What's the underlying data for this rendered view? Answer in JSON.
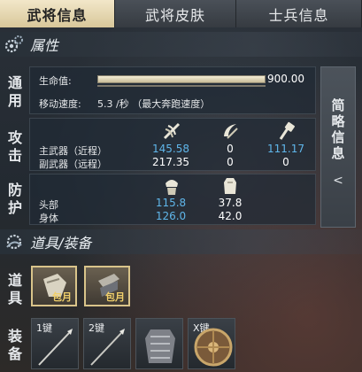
{
  "tabs": [
    {
      "label": "武将信息",
      "active": true
    },
    {
      "label": "武将皮肤",
      "active": false
    },
    {
      "label": "士兵信息",
      "active": false
    }
  ],
  "attributes": {
    "title": "属性",
    "general": {
      "side_label": "通用",
      "hp_label": "生命值:",
      "hp_value": "900.00",
      "hp_fill": 1.0,
      "speed_label": "移动速度:",
      "speed_value": "5.3 /秒 （最大奔跑速度）"
    },
    "attack": {
      "side_label": "攻击",
      "main_label": "主武器（近程）",
      "sub_label": "副武器（远程）",
      "columns": [
        {
          "icon": "slash-attack-icon",
          "main": "145.58",
          "sub": "217.35"
        },
        {
          "icon": "crescent-blade-icon",
          "main": "0",
          "sub": "0"
        },
        {
          "icon": "blunt-hammer-icon",
          "main": "111.17",
          "sub": "0"
        }
      ]
    },
    "defense": {
      "side_label": "防护",
      "head_label": "头部",
      "body_label": "身体",
      "columns": [
        {
          "icon": "helmet-armor-icon",
          "head": "115.8",
          "body": "126.0"
        },
        {
          "icon": "body-armor-icon",
          "head": "37.8",
          "body": "42.0"
        }
      ]
    }
  },
  "side_tab": {
    "label": "简略信息",
    "arrow": "<"
  },
  "equipment": {
    "title": "道具/装备",
    "items_side_label": "道具",
    "gear_side_label": "装备",
    "items": [
      {
        "tag": "包月",
        "icon": "gauntlet-item-icon"
      },
      {
        "tag": "包月",
        "icon": "armguard-item-icon"
      }
    ],
    "gear": [
      {
        "key": "1键",
        "icon": "spear-icon"
      },
      {
        "key": "2键",
        "icon": "javelin-icon"
      },
      {
        "key": "",
        "icon": "chest-armor-icon"
      },
      {
        "key": "X键",
        "icon": "round-shield-icon"
      }
    ]
  },
  "colors": {
    "accent_blue": "#5fb6ea",
    "tab_active": "#f2e7c9",
    "item_tag": "#f0cf6b"
  }
}
